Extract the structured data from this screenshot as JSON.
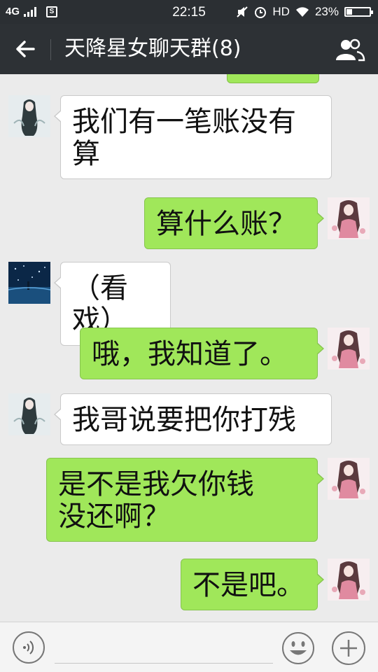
{
  "status_bar": {
    "network": "4G",
    "sim_label": "S",
    "time": "22:15",
    "hd": "HD",
    "battery_percent": "23%",
    "battery_level": 0.23
  },
  "header": {
    "title": "天降星女聊天群(8)",
    "back_icon": "arrow-left-icon",
    "members_icon": "group-members-icon"
  },
  "messages": [
    {
      "side": "in",
      "sender_avatar": "avatar-girl-ghost",
      "lines": [
        "我们有一笔账没有",
        "算"
      ]
    },
    {
      "side": "out",
      "sender_avatar": "avatar-girl-pink",
      "lines": [
        "算什么账？"
      ]
    },
    {
      "side": "in",
      "sender_avatar": "avatar-night-sky",
      "lines": [
        "（看戏）"
      ]
    },
    {
      "side": "out",
      "sender_avatar": "avatar-girl-pink",
      "lines": [
        "哦，我知道了。"
      ]
    },
    {
      "side": "in",
      "sender_avatar": "avatar-girl-ghost",
      "lines": [
        "我哥说要把你打残"
      ]
    },
    {
      "side": "out",
      "sender_avatar": "avatar-girl-pink",
      "lines": [
        "是不是我欠你钱",
        "没还啊？"
      ]
    },
    {
      "side": "out",
      "sender_avatar": "avatar-girl-pink",
      "lines": [
        "不是吧。"
      ]
    }
  ],
  "input_bar": {
    "voice_icon": "voice-input-icon",
    "emoji_icon": "emoji-smile-icon",
    "plus_icon": "plus-icon"
  },
  "colors": {
    "header_bg": "#2d3135",
    "chat_bg": "#ebebeb",
    "outgoing_bubble": "#a0e75a",
    "incoming_bubble": "#ffffff"
  }
}
